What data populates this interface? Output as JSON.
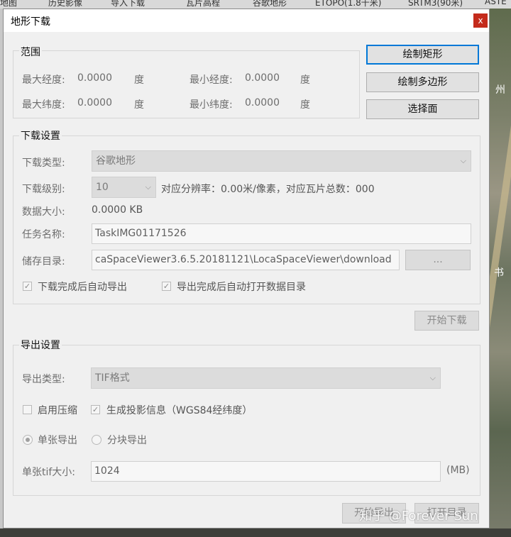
{
  "background": {
    "toolbar_items": [
      "/地图",
      "历史影像",
      "导入下载",
      "瓦片高程",
      "谷歌地形",
      "ETOPO(1.8千米)",
      "SRTM3(90米)",
      "ASTE"
    ],
    "map_labels": [
      "州",
      "书"
    ]
  },
  "dialog": {
    "title": "地形下载",
    "close_label": "x"
  },
  "range": {
    "title": "范围",
    "max_lon_label": "最大经度:",
    "max_lon_value": "0.0000",
    "min_lon_label": "最小经度:",
    "min_lon_value": "0.0000",
    "max_lat_label": "最大纬度:",
    "max_lat_value": "0.0000",
    "min_lat_label": "最小纬度:",
    "min_lat_value": "0.0000",
    "unit": "度"
  },
  "actions": {
    "draw_rect": "绘制矩形",
    "draw_polygon": "绘制多边形",
    "select_face": "选择面"
  },
  "download": {
    "title": "下载设置",
    "type_label": "下载类型:",
    "type_value": "谷歌地形",
    "level_label": "下载级别:",
    "level_value": "10",
    "resolution_text": "对应分辨率：0.00米/像素，对应瓦片总数：000",
    "size_label": "数据大小:",
    "size_value": "0.0000 KB",
    "task_label": "任务名称:",
    "task_value": "TaskIMG01171526",
    "dir_label": "储存目录:",
    "dir_value": "caSpaceViewer3.6.5.20181121\\LocaSpaceViewer\\download",
    "browse_label": "...",
    "auto_export_label": "下载完成后自动导出",
    "auto_export_checked": true,
    "auto_open_label": "导出完成后自动打开数据目录",
    "auto_open_checked": true,
    "start_label": "开始下载"
  },
  "export": {
    "title": "导出设置",
    "type_label": "导出类型:",
    "type_value": "TIF格式",
    "compress_label": "启用压缩",
    "compress_checked": false,
    "proj_label": "生成投影信息（WGS84经纬度）",
    "proj_checked": true,
    "single_label": "单张导出",
    "block_label": "分块导出",
    "tif_size_label": "单张tif大小:",
    "tif_size_value": "1024",
    "tif_size_unit": "(MB)",
    "start_export_label": "开始导出",
    "open_dir_label": "打开目录"
  },
  "watermark": "知乎 @Forever Sun"
}
